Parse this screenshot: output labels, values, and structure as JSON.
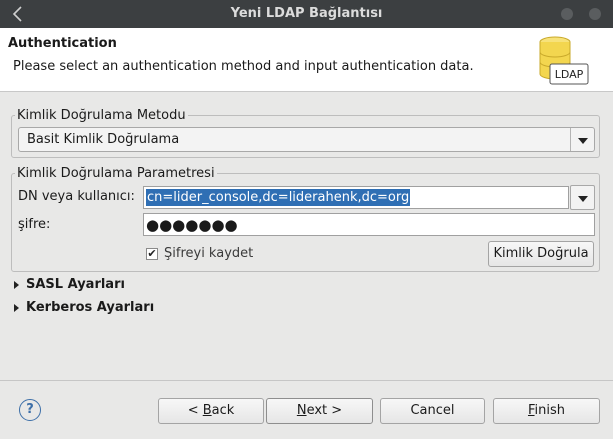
{
  "window": {
    "title": "Yeni LDAP Bağlantısı"
  },
  "header": {
    "title": "Authentication",
    "description": "Please select an authentication method and input authentication data.",
    "icon": "ldap-database-icon",
    "icon_label": "LDAP"
  },
  "method_group": {
    "legend": "Kimlik Doğrulama Metodu",
    "selected": "Basit Kimlik Doğrulama"
  },
  "params_group": {
    "legend": "Kimlik Doğrulama Parametresi",
    "dn_label": "DN veya kullanıcı:",
    "dn_value": "cn=lider_console,dc=liderahenk,dc=org",
    "password_label": "şifre:",
    "password_value": "●●●●●●●",
    "save_password_label": "Şifreyi kaydet",
    "save_password_checked": true,
    "check_auth_button": "Kimlik Doğrula"
  },
  "sections": [
    {
      "label": "SASL Ayarları",
      "expanded": false
    },
    {
      "label": "Kerberos Ayarları",
      "expanded": false
    }
  ],
  "footer": {
    "help_icon": "help-icon",
    "back_prefix": "< ",
    "back_mnemonic": "B",
    "back_rest": "ack",
    "next_mnemonic": "N",
    "next_rest": "ext >",
    "cancel": "Cancel",
    "finish_mnemonic": "F",
    "finish_rest": "inish"
  },
  "colors": {
    "titlebar": "#3c3f41",
    "selection": "#2f6fb4",
    "dialog_bg": "#e8e8e7",
    "header_bg": "#ffffff",
    "help_accent": "#3d6fa8"
  }
}
